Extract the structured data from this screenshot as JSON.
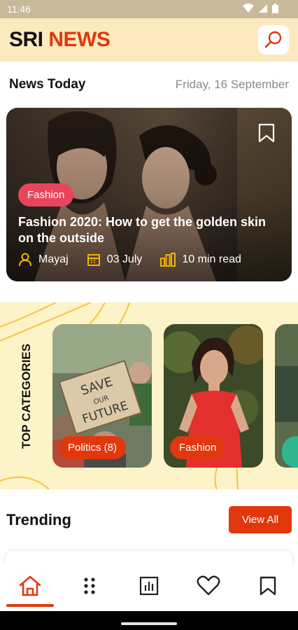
{
  "status_bar": {
    "time": "11:46"
  },
  "header": {
    "brand_part1": "SRI",
    "brand_part2": "NEWS"
  },
  "news_today": {
    "title": "News Today",
    "date": "Friday, 16 September"
  },
  "hero": {
    "tag": "Fashion",
    "title": "Fashion 2020: How to get the golden skin on the outside",
    "author": "Mayaj",
    "date": "03 July",
    "read_time": "10 min read"
  },
  "categories": {
    "label": "TOP CATEGORIES",
    "items": [
      {
        "name": "Politics (8)"
      },
      {
        "name": "Fashion"
      }
    ]
  },
  "trending": {
    "title": "Trending",
    "view_all": "View All"
  },
  "bottom_nav": {
    "items": [
      "home-icon",
      "grid-icon",
      "chart-icon",
      "heart-icon",
      "bookmark-icon"
    ],
    "active": "home-icon"
  },
  "colors": {
    "accent": "#e0380c",
    "header_bg": "#fde9bf",
    "tag_pink": "#e8455a",
    "categories_bg": "#fdf3c8"
  }
}
